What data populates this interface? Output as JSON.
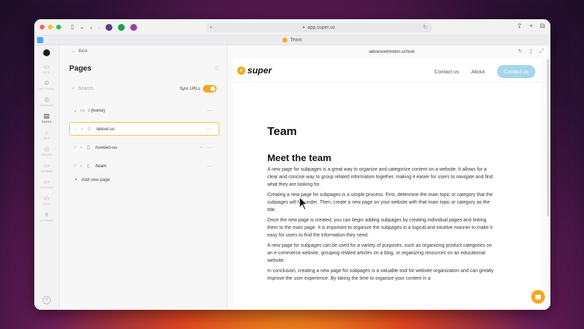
{
  "browser": {
    "address": "app.super.so",
    "tab_title": "Team",
    "colors": {
      "red": "#ff5f57",
      "yellow": "#febc2e",
      "green": "#28c840"
    }
  },
  "rail": {
    "items": [
      {
        "label": "SITE",
        "icon": "monitor-icon"
      },
      {
        "label": "SETTINGS",
        "icon": "gear-icon"
      },
      {
        "label": "DOMAINS",
        "icon": "globe-icon"
      },
      {
        "label": "PAGES",
        "icon": "file-icon"
      },
      {
        "label": "SEO",
        "icon": "search-icon"
      },
      {
        "label": "DESIGN",
        "icon": "palette-icon"
      },
      {
        "label": "NAVBAR",
        "icon": "navbar-icon"
      },
      {
        "label": "FOOTER",
        "icon": "footer-icon"
      },
      {
        "label": "CODE",
        "icon": "code-icon"
      },
      {
        "label": "SITEMAP",
        "icon": "sitemap-icon"
      }
    ]
  },
  "panel": {
    "back": "Back",
    "title": "Pages",
    "search_placeholder": "Search",
    "sync_label": "Sync URLs",
    "pages": [
      {
        "path": "/ (home)"
      },
      {
        "path": "/about-us"
      },
      {
        "path": "/contact-us"
      },
      {
        "path": "/team"
      }
    ],
    "add_page": "Add new page"
  },
  "preview": {
    "domain": "advancednotion.school",
    "brand": "super",
    "nav": {
      "contact": "Contact us",
      "about": "About",
      "cta": "Contact us"
    },
    "heading": "Team",
    "subheading": "Meet the team",
    "paragraphs": [
      "A new page for subpages is a great way to organize and categorize content on a website. It allows for a clear and concise way to group related information together, making it easier for users to navigate and find what they are looking for.",
      "Creating a new page for subpages is a simple process. First, determine the main topic or category that the subpages will fall under. Then, create a new page on your website with that main topic or category as the title.",
      "Once the new page is created, you can begin adding subpages by creating individual pages and linking them to the main page. It is important to organize the subpages in a logical and intuitive manner to make it easy for users to find the information they need.",
      "A new page for subpages can be used for a variety of purposes, such as organizing product categories on an e-commerce website, grouping related articles on a blog, or organizing resources on an educational website.",
      "In conclusion, creating a new page for subpages is a valuable tool for website organization and can greatly improve the user experience. By taking the time to organize your content in a"
    ]
  },
  "accent": "#f5a623"
}
